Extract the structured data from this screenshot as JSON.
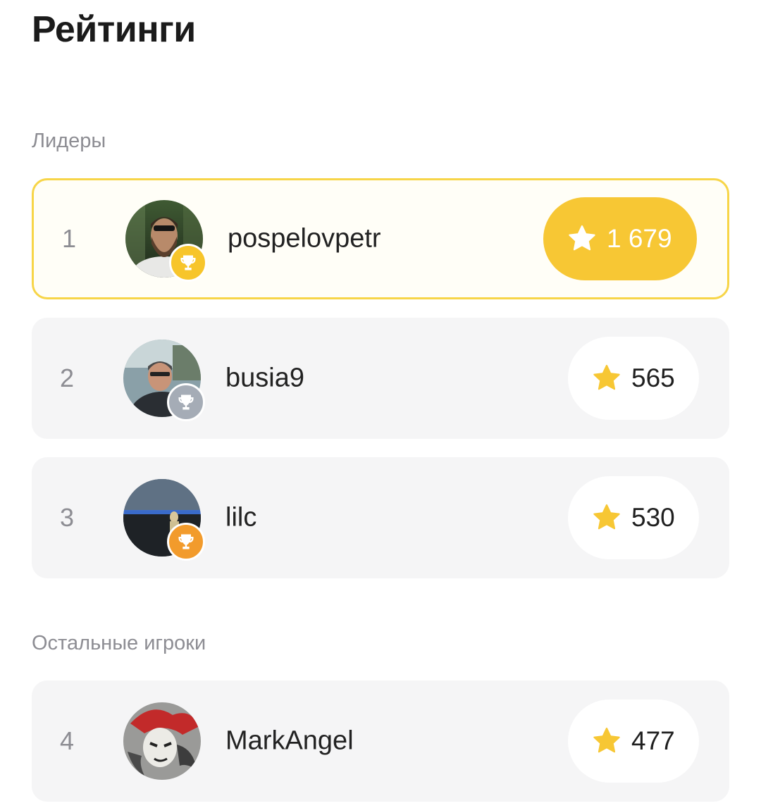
{
  "page": {
    "title": "Рейтинги"
  },
  "sections": {
    "leaders_title": "Лидеры",
    "others_title": "Остальные игроки"
  },
  "leaders": [
    {
      "rank": "1",
      "username": "pospelovpetr",
      "score": "1 679",
      "medal": "gold"
    },
    {
      "rank": "2",
      "username": "busia9",
      "score": "565",
      "medal": "silver"
    },
    {
      "rank": "3",
      "username": "lilc",
      "score": "530",
      "medal": "bronze"
    }
  ],
  "others": [
    {
      "rank": "4",
      "username": "MarkAngel",
      "score": "477"
    }
  ],
  "colors": {
    "accent_gold": "#f7c734",
    "card_highlight_border": "#f7d548",
    "card_bg": "#f5f5f6",
    "medal_silver": "#a5acb6",
    "medal_bronze": "#f29b2c",
    "muted_text": "#8d8d93"
  },
  "icons": {
    "score": "star-icon",
    "medal": "trophy-icon"
  }
}
